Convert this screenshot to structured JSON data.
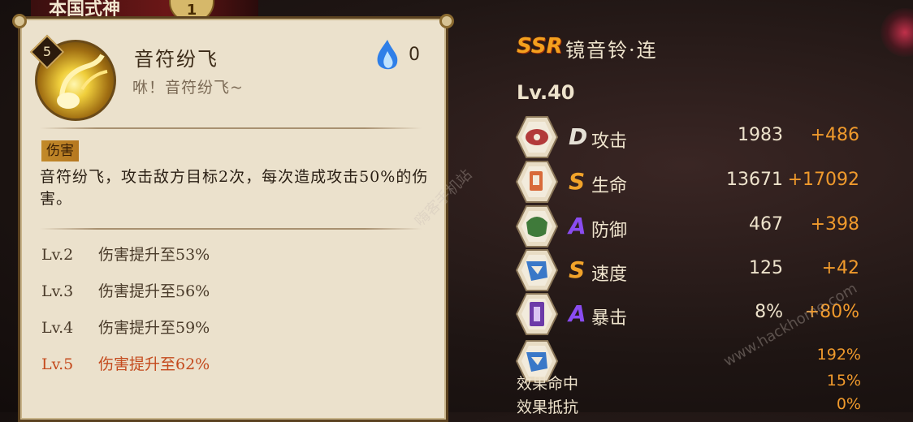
{
  "banner": {
    "title": "本国式神",
    "badge": "1"
  },
  "skill": {
    "level": "5",
    "name": "音符纷飞",
    "subtitle": "咻！音符纷飞~",
    "cost_value": "0",
    "tag": "伤害",
    "description": "音符纷飞，攻击敌方目标2次，每次造成攻击50%的伤害。",
    "upgrades": [
      {
        "lv": "Lv.2",
        "text": "伤害提升至53%",
        "active": false
      },
      {
        "lv": "Lv.3",
        "text": "伤害提升至56%",
        "active": false
      },
      {
        "lv": "Lv.4",
        "text": "伤害提升至59%",
        "active": false
      },
      {
        "lv": "Lv.5",
        "text": "伤害提升至62%",
        "active": true
      }
    ]
  },
  "shikigami": {
    "rarity": "SSR",
    "name": "镜音铃·连",
    "level": "Lv.40",
    "stats": [
      {
        "icon": "attack-icon",
        "grade": "D",
        "label": "攻击",
        "base": "1983",
        "bonus": "+486"
      },
      {
        "icon": "health-icon",
        "grade": "S",
        "label": "生命",
        "base": "13671",
        "bonus": "+17092"
      },
      {
        "icon": "defense-icon",
        "grade": "A",
        "label": "防御",
        "base": "467",
        "bonus": "+398"
      },
      {
        "icon": "speed-icon",
        "grade": "S",
        "label": "速度",
        "base": "125",
        "bonus": "+42"
      },
      {
        "icon": "crit-icon",
        "grade": "A",
        "label": "暴击",
        "base": "8%",
        "bonus": "+80%"
      }
    ],
    "extra_stats": [
      {
        "label": "",
        "value": "192%"
      },
      {
        "label": "效果命中",
        "value": "15%"
      },
      {
        "label": "效果抵抗",
        "value": "0%"
      }
    ]
  },
  "watermark": {
    "cn": "嗨客手机站",
    "url": "www.hackhome.com"
  },
  "colors": {
    "accent_orange": "#f09a2c",
    "active_red": "#c44a1d",
    "panel_bg": "#ebe1cc"
  }
}
